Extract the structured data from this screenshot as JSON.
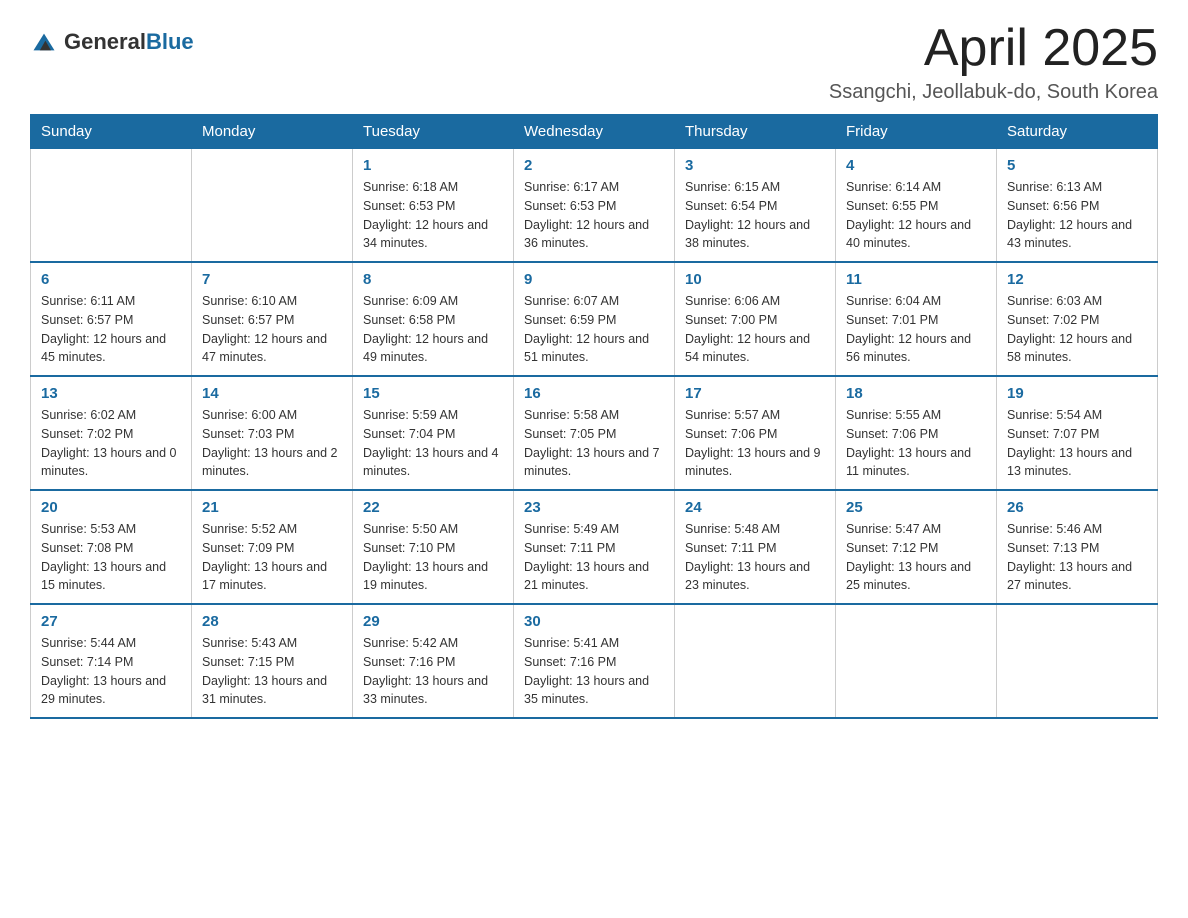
{
  "header": {
    "logo_general": "General",
    "logo_blue": "Blue",
    "month_title": "April 2025",
    "location": "Ssangchi, Jeollabuk-do, South Korea"
  },
  "weekdays": [
    "Sunday",
    "Monday",
    "Tuesday",
    "Wednesday",
    "Thursday",
    "Friday",
    "Saturday"
  ],
  "weeks": [
    [
      {
        "day": "",
        "sunrise": "",
        "sunset": "",
        "daylight": ""
      },
      {
        "day": "",
        "sunrise": "",
        "sunset": "",
        "daylight": ""
      },
      {
        "day": "1",
        "sunrise": "Sunrise: 6:18 AM",
        "sunset": "Sunset: 6:53 PM",
        "daylight": "Daylight: 12 hours and 34 minutes."
      },
      {
        "day": "2",
        "sunrise": "Sunrise: 6:17 AM",
        "sunset": "Sunset: 6:53 PM",
        "daylight": "Daylight: 12 hours and 36 minutes."
      },
      {
        "day": "3",
        "sunrise": "Sunrise: 6:15 AM",
        "sunset": "Sunset: 6:54 PM",
        "daylight": "Daylight: 12 hours and 38 minutes."
      },
      {
        "day": "4",
        "sunrise": "Sunrise: 6:14 AM",
        "sunset": "Sunset: 6:55 PM",
        "daylight": "Daylight: 12 hours and 40 minutes."
      },
      {
        "day": "5",
        "sunrise": "Sunrise: 6:13 AM",
        "sunset": "Sunset: 6:56 PM",
        "daylight": "Daylight: 12 hours and 43 minutes."
      }
    ],
    [
      {
        "day": "6",
        "sunrise": "Sunrise: 6:11 AM",
        "sunset": "Sunset: 6:57 PM",
        "daylight": "Daylight: 12 hours and 45 minutes."
      },
      {
        "day": "7",
        "sunrise": "Sunrise: 6:10 AM",
        "sunset": "Sunset: 6:57 PM",
        "daylight": "Daylight: 12 hours and 47 minutes."
      },
      {
        "day": "8",
        "sunrise": "Sunrise: 6:09 AM",
        "sunset": "Sunset: 6:58 PM",
        "daylight": "Daylight: 12 hours and 49 minutes."
      },
      {
        "day": "9",
        "sunrise": "Sunrise: 6:07 AM",
        "sunset": "Sunset: 6:59 PM",
        "daylight": "Daylight: 12 hours and 51 minutes."
      },
      {
        "day": "10",
        "sunrise": "Sunrise: 6:06 AM",
        "sunset": "Sunset: 7:00 PM",
        "daylight": "Daylight: 12 hours and 54 minutes."
      },
      {
        "day": "11",
        "sunrise": "Sunrise: 6:04 AM",
        "sunset": "Sunset: 7:01 PM",
        "daylight": "Daylight: 12 hours and 56 minutes."
      },
      {
        "day": "12",
        "sunrise": "Sunrise: 6:03 AM",
        "sunset": "Sunset: 7:02 PM",
        "daylight": "Daylight: 12 hours and 58 minutes."
      }
    ],
    [
      {
        "day": "13",
        "sunrise": "Sunrise: 6:02 AM",
        "sunset": "Sunset: 7:02 PM",
        "daylight": "Daylight: 13 hours and 0 minutes."
      },
      {
        "day": "14",
        "sunrise": "Sunrise: 6:00 AM",
        "sunset": "Sunset: 7:03 PM",
        "daylight": "Daylight: 13 hours and 2 minutes."
      },
      {
        "day": "15",
        "sunrise": "Sunrise: 5:59 AM",
        "sunset": "Sunset: 7:04 PM",
        "daylight": "Daylight: 13 hours and 4 minutes."
      },
      {
        "day": "16",
        "sunrise": "Sunrise: 5:58 AM",
        "sunset": "Sunset: 7:05 PM",
        "daylight": "Daylight: 13 hours and 7 minutes."
      },
      {
        "day": "17",
        "sunrise": "Sunrise: 5:57 AM",
        "sunset": "Sunset: 7:06 PM",
        "daylight": "Daylight: 13 hours and 9 minutes."
      },
      {
        "day": "18",
        "sunrise": "Sunrise: 5:55 AM",
        "sunset": "Sunset: 7:06 PM",
        "daylight": "Daylight: 13 hours and 11 minutes."
      },
      {
        "day": "19",
        "sunrise": "Sunrise: 5:54 AM",
        "sunset": "Sunset: 7:07 PM",
        "daylight": "Daylight: 13 hours and 13 minutes."
      }
    ],
    [
      {
        "day": "20",
        "sunrise": "Sunrise: 5:53 AM",
        "sunset": "Sunset: 7:08 PM",
        "daylight": "Daylight: 13 hours and 15 minutes."
      },
      {
        "day": "21",
        "sunrise": "Sunrise: 5:52 AM",
        "sunset": "Sunset: 7:09 PM",
        "daylight": "Daylight: 13 hours and 17 minutes."
      },
      {
        "day": "22",
        "sunrise": "Sunrise: 5:50 AM",
        "sunset": "Sunset: 7:10 PM",
        "daylight": "Daylight: 13 hours and 19 minutes."
      },
      {
        "day": "23",
        "sunrise": "Sunrise: 5:49 AM",
        "sunset": "Sunset: 7:11 PM",
        "daylight": "Daylight: 13 hours and 21 minutes."
      },
      {
        "day": "24",
        "sunrise": "Sunrise: 5:48 AM",
        "sunset": "Sunset: 7:11 PM",
        "daylight": "Daylight: 13 hours and 23 minutes."
      },
      {
        "day": "25",
        "sunrise": "Sunrise: 5:47 AM",
        "sunset": "Sunset: 7:12 PM",
        "daylight": "Daylight: 13 hours and 25 minutes."
      },
      {
        "day": "26",
        "sunrise": "Sunrise: 5:46 AM",
        "sunset": "Sunset: 7:13 PM",
        "daylight": "Daylight: 13 hours and 27 minutes."
      }
    ],
    [
      {
        "day": "27",
        "sunrise": "Sunrise: 5:44 AM",
        "sunset": "Sunset: 7:14 PM",
        "daylight": "Daylight: 13 hours and 29 minutes."
      },
      {
        "day": "28",
        "sunrise": "Sunrise: 5:43 AM",
        "sunset": "Sunset: 7:15 PM",
        "daylight": "Daylight: 13 hours and 31 minutes."
      },
      {
        "day": "29",
        "sunrise": "Sunrise: 5:42 AM",
        "sunset": "Sunset: 7:16 PM",
        "daylight": "Daylight: 13 hours and 33 minutes."
      },
      {
        "day": "30",
        "sunrise": "Sunrise: 5:41 AM",
        "sunset": "Sunset: 7:16 PM",
        "daylight": "Daylight: 13 hours and 35 minutes."
      },
      {
        "day": "",
        "sunrise": "",
        "sunset": "",
        "daylight": ""
      },
      {
        "day": "",
        "sunrise": "",
        "sunset": "",
        "daylight": ""
      },
      {
        "day": "",
        "sunrise": "",
        "sunset": "",
        "daylight": ""
      }
    ]
  ]
}
